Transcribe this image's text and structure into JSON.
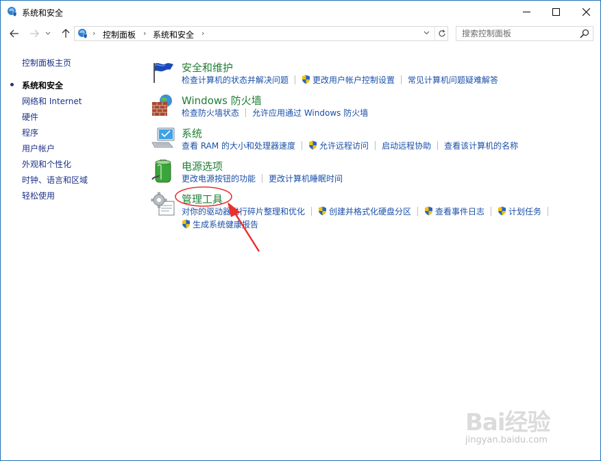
{
  "window": {
    "title": "系统和安全",
    "accent": "#1f6fb5"
  },
  "nav": {
    "breadcrumb": [
      "控制面板",
      "系统和安全"
    ],
    "search_placeholder": "搜索控制面板"
  },
  "sidebar": {
    "items": [
      {
        "label": "控制面板主页"
      },
      {
        "label": "系统和安全",
        "current": true
      },
      {
        "label": "网络和 Internet"
      },
      {
        "label": "硬件"
      },
      {
        "label": "程序"
      },
      {
        "label": "用户帐户"
      },
      {
        "label": "外观和个性化"
      },
      {
        "label": "时钟、语言和区域"
      },
      {
        "label": "轻松使用"
      }
    ]
  },
  "categories": [
    {
      "title": "安全和维护",
      "icon": "flag-icon",
      "links": [
        {
          "label": "检查计算机的状态并解决问题",
          "shield": false
        },
        {
          "label": "更改用户帐户控制设置",
          "shield": true
        },
        {
          "label": "常见计算机问题疑难解答",
          "shield": false
        }
      ]
    },
    {
      "title": "Windows 防火墙",
      "icon": "firewall-icon",
      "links": [
        {
          "label": "检查防火墙状态",
          "shield": false
        },
        {
          "label": "允许应用通过 Windows 防火墙",
          "shield": false
        }
      ]
    },
    {
      "title": "系统",
      "icon": "computer-icon",
      "links": [
        {
          "label": "查看 RAM 的大小和处理器速度",
          "shield": false
        },
        {
          "label": "允许远程访问",
          "shield": true
        },
        {
          "label": "启动远程协助",
          "shield": false
        },
        {
          "label": "查看该计算机的名称",
          "shield": false
        }
      ]
    },
    {
      "title": "电源选项",
      "icon": "battery-icon",
      "links": [
        {
          "label": "更改电源按钮的功能",
          "shield": false
        },
        {
          "label": "更改计算机睡眠时间",
          "shield": false
        }
      ]
    },
    {
      "title": "管理工具",
      "icon": "admin-tools-icon",
      "links": [
        {
          "label": "对你的驱动器进行碎片整理和优化",
          "shield": false
        },
        {
          "label": "创建并格式化硬盘分区",
          "shield": true
        },
        {
          "label": "查看事件日志",
          "shield": true
        },
        {
          "label": "计划任务",
          "shield": true
        },
        {
          "label": "生成系统健康报告",
          "shield": true
        }
      ]
    }
  ],
  "annotation": {
    "color": "#e8312f"
  },
  "watermark": {
    "brand": "Bai经验",
    "url": "jingyan.baidu.com"
  }
}
